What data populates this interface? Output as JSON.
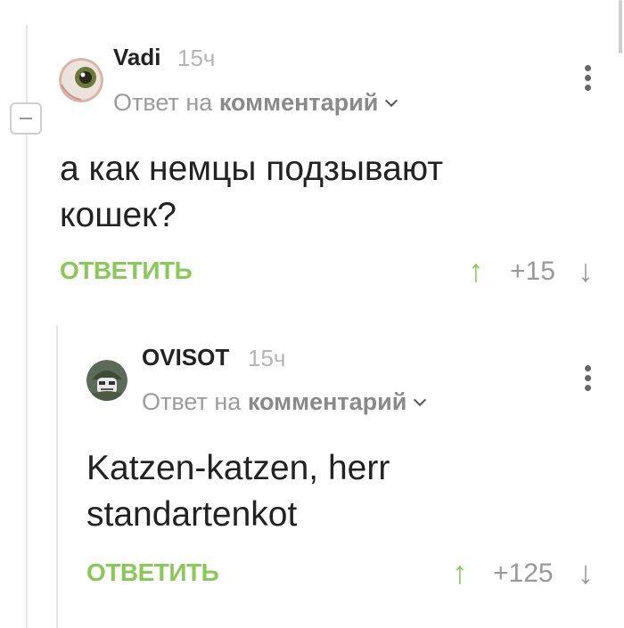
{
  "comments": [
    {
      "author": "Vadi",
      "time": "15ч",
      "reply_prefix": "Ответ на",
      "reply_target": "комментарий",
      "text_line1": "а как немцы подзывают",
      "text_line2": "кошек?",
      "reply_label": "ОТВЕТИТЬ",
      "score": "+15"
    },
    {
      "author": "OVISOT",
      "time": "15ч",
      "reply_prefix": "Ответ на",
      "reply_target": "комментарий",
      "text_line1": "Katzen-katzen, herr",
      "text_line2": "standartenkot",
      "reply_label": "ОТВЕТИТЬ",
      "score": "+125"
    }
  ],
  "icons": {
    "up_arrow": "↑",
    "down_arrow": "↓"
  },
  "colors": {
    "accent": "#8ac858",
    "muted": "#9a9a9a"
  }
}
